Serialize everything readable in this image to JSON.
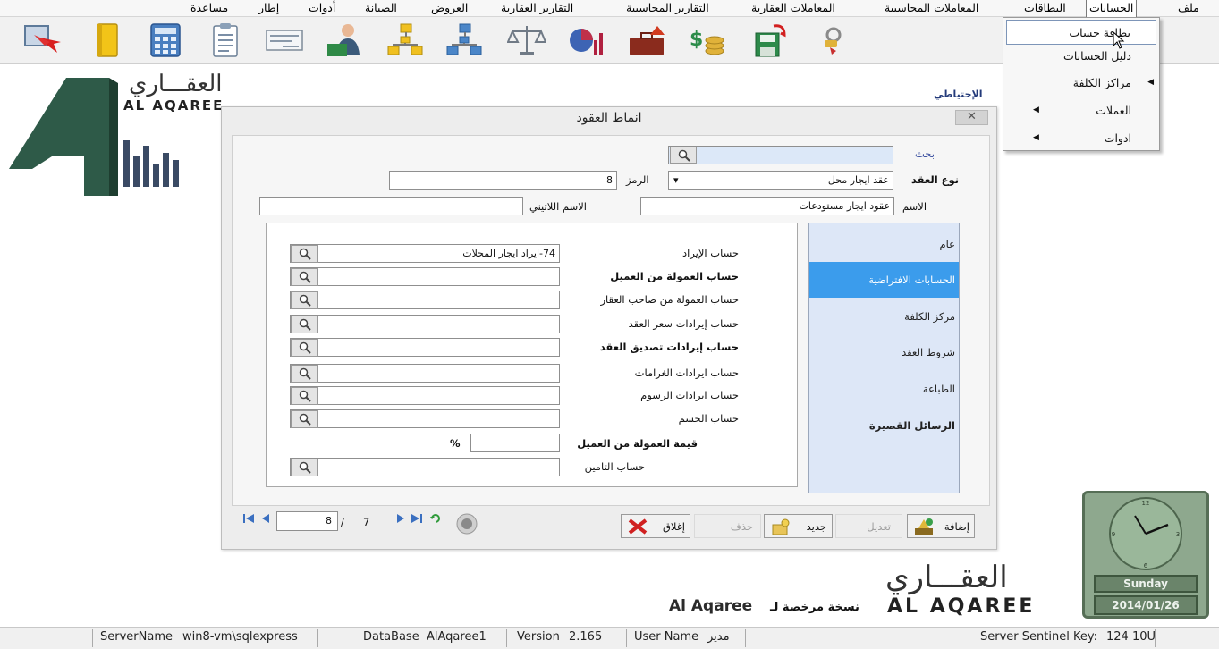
{
  "menu": {
    "file": "ملف",
    "accounts": "الحسابات",
    "cards": "البطاقات",
    "accounting_transactions": "المعاملات المحاسبية",
    "property_transactions": "المعاملات العقارية",
    "accounting_reports": "التقارير المحاسبية",
    "property_reports": "التقارير العقارية",
    "offers": "العروض",
    "maintenance": "الصيانة",
    "tools": "أدوات",
    "frame": "إطار",
    "help": "مساعدة"
  },
  "accounts_menu": {
    "account_card": "بطاقة حساب",
    "chart_of_accounts": "دليل الحسابات",
    "cost_centers": "مراكز الكلفة",
    "currencies": "العملات",
    "tools": "ادوات"
  },
  "toolbar": {
    "icons": [
      "exit-arrow-icon",
      "book-icon",
      "calculator-icon",
      "clipboard-icon",
      "cheque-icon",
      "user-desk-icon",
      "tree-chart-icon",
      "org-chart-icon",
      "balance-scale-icon",
      "pie-chart-icon",
      "briefcase-house-icon",
      "money-coins-icon",
      "save-disk-icon",
      "key-tag-icon"
    ]
  },
  "logo": {
    "arabic": "العقـــاري",
    "latin": "AL AQAREE"
  },
  "side": {
    "backup_label": "الإحتياطي"
  },
  "dialog": {
    "title": "انماط العقود",
    "close": "✕",
    "search_label": "بحث",
    "contract_type_label": "نوع العقد",
    "contract_type_value": "عقد ايجار محل",
    "code_label": "الرمز",
    "code_value": "8",
    "name_label": "الاسم",
    "name_value": "عقود ايجار مستودعات",
    "latin_name_label": "الاسم اللاتيني",
    "latin_name_value": ""
  },
  "tabs": [
    {
      "label": "عام"
    },
    {
      "label": "الحسابات الافتراضية"
    },
    {
      "label": "مركز الكلفة"
    },
    {
      "label": "شروط العقد"
    },
    {
      "label": "الطباعة"
    },
    {
      "label": "الرسائل القصيرة"
    }
  ],
  "default_accounts": [
    {
      "label": "حساب الإيراد",
      "value": "74-ايراد ايجار المحلات",
      "bold": false
    },
    {
      "label": "حساب العمولة من العميل",
      "value": "",
      "bold": true
    },
    {
      "label": "حساب العمولة من صاحب العقار",
      "value": "",
      "bold": false
    },
    {
      "label": "حساب إيرادات سعر العقد",
      "value": "",
      "bold": false
    },
    {
      "label": "حساب إيرادات تصديق العقد",
      "value": "",
      "bold": true
    },
    {
      "label": "حساب ايرادات الغرامات",
      "value": "",
      "bold": false
    },
    {
      "label": "حساب ايرادات الرسوم",
      "value": "",
      "bold": false
    },
    {
      "label": "حساب الحسم",
      "value": "",
      "bold": false
    }
  ],
  "commission": {
    "label": "قيمة العمولة من العميل",
    "symbol": "%",
    "value": ""
  },
  "insurance": {
    "label": "حساب التامين",
    "value": ""
  },
  "buttons": {
    "add": "إضافة",
    "edit": "تعديل",
    "new": "جديد",
    "delete": "حذف",
    "close": "إغلاق"
  },
  "navigator": {
    "current": "8",
    "separator": "/",
    "total": "7"
  },
  "branding": {
    "arabic": "العقـــاري",
    "latin": "AL AQAREE",
    "licensed_to": "نسخة مرخصة لـ",
    "licensee": "Al Aqaree"
  },
  "clock": {
    "day": "Sunday",
    "date": "2014/01/26"
  },
  "status": {
    "server_label": "ServerName",
    "server_value": "win8-vm\\sqlexpress",
    "db_label": "DataBase",
    "db_value": "AlAqaree1",
    "version_label": "Version",
    "version_value": "2.165",
    "user_label": "User Name",
    "user_value": "مدير",
    "sentinel_label": "Server Sentinel Key:",
    "sentinel_value": "124 10U"
  },
  "colors": {
    "active_tab": "#3b9cec",
    "tab_bg": "#dde7f7",
    "logo_green": "#2e5a48",
    "clock_green": "#8ea88e"
  }
}
